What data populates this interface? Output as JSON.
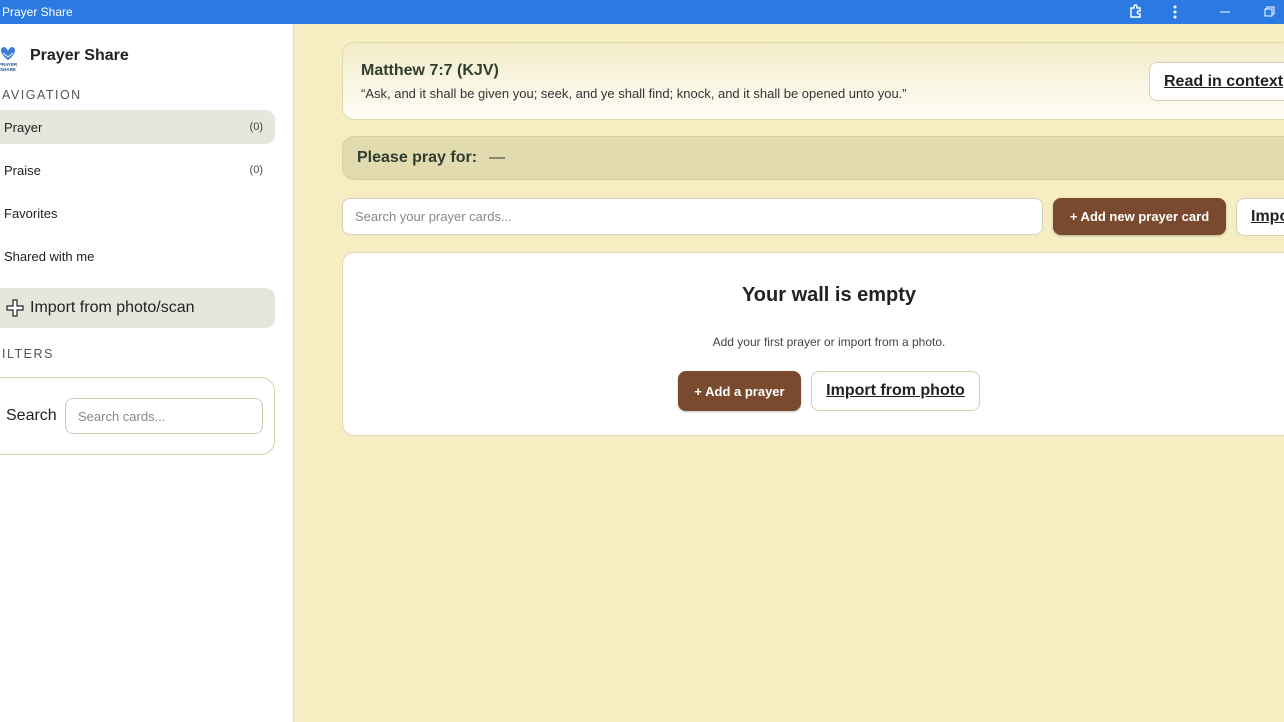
{
  "window": {
    "title": "Prayer Share",
    "controls": [
      "extension-icon",
      "more-icon",
      "minimize-icon",
      "restore-icon"
    ]
  },
  "sidebar": {
    "brand_title": "Prayer Share",
    "logo_text": "PRAYER SHARE",
    "nav_heading": "AVIGATION",
    "nav_items": [
      {
        "label": "Prayer",
        "count": "(0)"
      },
      {
        "label": "Praise",
        "count": "(0)"
      },
      {
        "label": "Favorites",
        "count": ""
      },
      {
        "label": "Shared with me",
        "count": ""
      }
    ],
    "import_label": "Import from photo/scan",
    "filters_heading": "ILTERS",
    "search_label": "Search",
    "search_placeholder": "Search cards..."
  },
  "main": {
    "verse": {
      "reference": "Matthew 7:7 (KJV)",
      "text": "“Ask, and it shall be given you; seek, and ye shall find; knock, and it shall be opened unto you.”",
      "context_button": "Read in context"
    },
    "pray_for": {
      "label": "Please pray for:",
      "value": "—"
    },
    "toolbar": {
      "search_placeholder": "Search your prayer cards...",
      "add_button": "+ Add new prayer card",
      "import_button": "Import"
    },
    "empty_state": {
      "title": "Your wall is empty",
      "subtitle": "Add your first prayer or import from a photo.",
      "add_button": "+ Add a prayer",
      "import_button": "Import from photo"
    }
  },
  "colors": {
    "titlebar": "#2a7ae2",
    "background": "#f6edc3",
    "brown_button": "#7a4a2e",
    "active_nav": "#e6e6dd"
  }
}
